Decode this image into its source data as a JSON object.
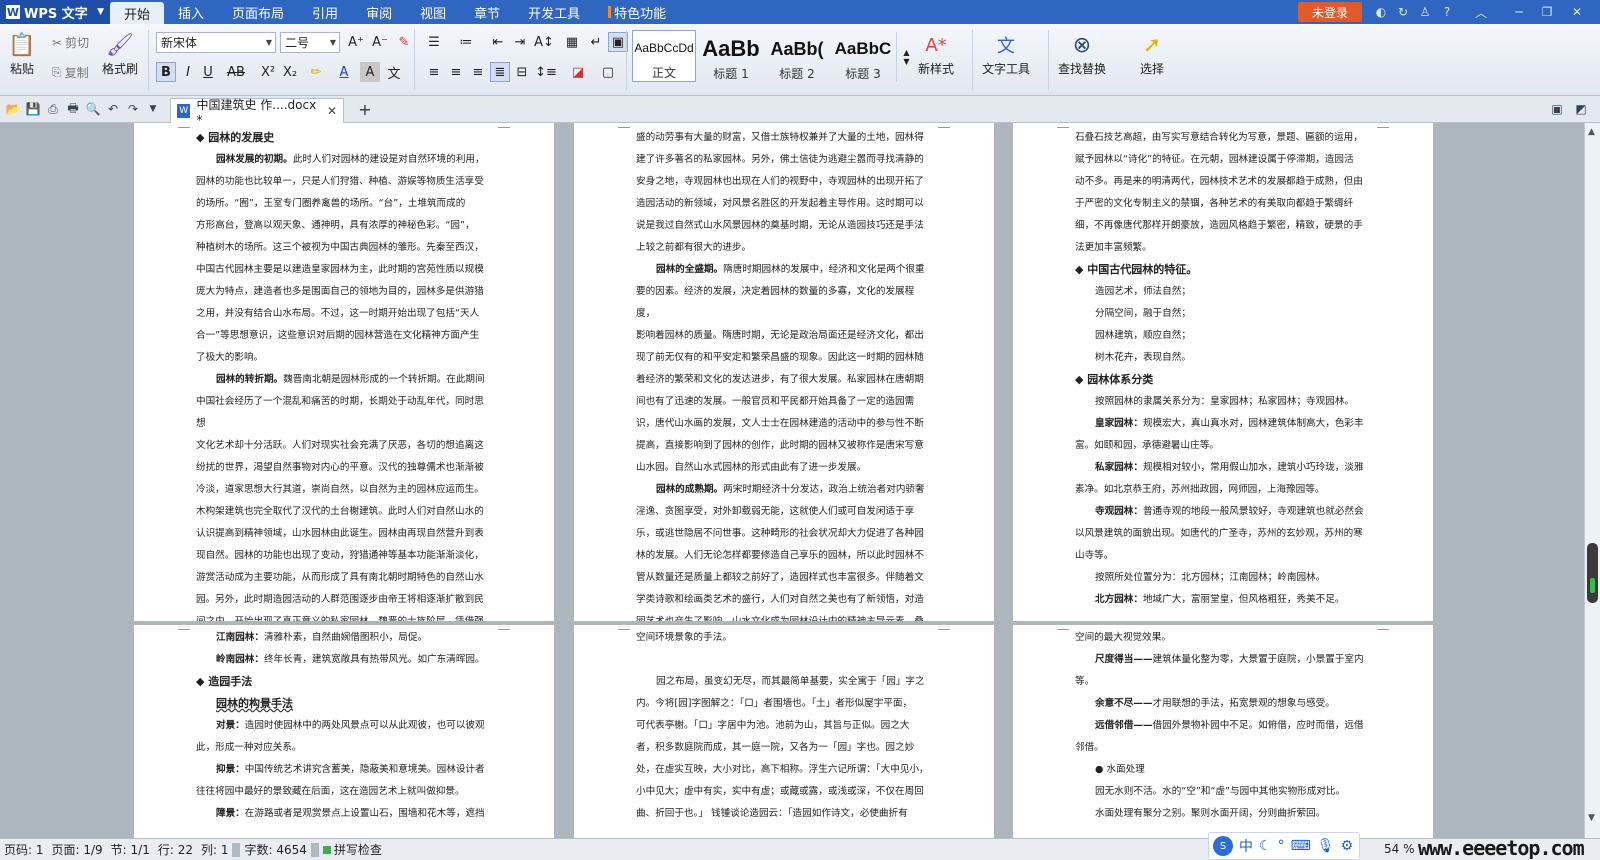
{
  "app": {
    "name": "WPS 文字",
    "login": "未登录"
  },
  "menu": [
    "开始",
    "插入",
    "页面布局",
    "引用",
    "审阅",
    "视图",
    "章节",
    "开发工具",
    "特色功能"
  ],
  "ribbon": {
    "paste": "粘贴",
    "cut": "剪切",
    "copy": "复制",
    "format_painter": "格式刷",
    "font_name": "新宋体",
    "font_size": "二号",
    "styles": [
      {
        "preview": "AaBbCcDd",
        "name": "正文"
      },
      {
        "preview": "AaBb",
        "name": "标题 1"
      },
      {
        "preview": "AaBb(",
        "name": "标题 2"
      },
      {
        "preview": "AaBbC",
        "name": "标题 3"
      }
    ],
    "new_style": "新样式",
    "text_tools": "文字工具",
    "find_replace": "查找替换",
    "select": "选择"
  },
  "tab": {
    "filename": "中国建筑史 作....docx *"
  },
  "pages": {
    "p1": [
      {
        "t": "◆ 园林的发展史",
        "c": "h"
      },
      {
        "t": "园林发展的初期。此时人们对园林的建设是对自然环境的利用，",
        "c": "ind",
        "lead": "园林发展的初期。"
      },
      {
        "t": "园林的功能也比较单一，只是人们狩猎、种植、游娱等物质生活享受"
      },
      {
        "t": "的场所。“囿”，王室专门圈养禽兽的场所。“台”，土堆筑而成的"
      },
      {
        "t": "方形高台，登高以观天象、通神明，具有浓厚的神秘色彩。“园”，"
      },
      {
        "t": "种植树木的场所。这三个被视为中国古典园林的雏形。先秦至西汉，"
      },
      {
        "t": "中国古代园林主要是以建造皇家园林为主，此时期的宫苑性质以规模"
      },
      {
        "t": "庞大为特点，建造者也多是围面自己的领地为目的，园林多是供游猎"
      },
      {
        "t": "之用，并没有结合山水布局。不过，这一时期开始出现了包括“天人"
      },
      {
        "t": "合一”等思想意识，这些意识对后期的园林营造在文化精神方面产生"
      },
      {
        "t": "了极大的影响。"
      },
      {
        "t": "园林的转折期。魏晋南北朝是园林形成的一个转折期。在此期间",
        "c": "ind",
        "lead": "园林的转折期。"
      },
      {
        "t": "中国社会经历了一个混乱和痛苦的时期，长期处于动乱年代，同时思想"
      },
      {
        "t": "文化艺术却十分活跃。人们对现实社会充满了厌恶，各切的想追离这"
      },
      {
        "t": "纷扰的世界，渴望自然事物对内心的平意。汉代的独尊儒术也渐渐被"
      },
      {
        "t": "冷淡，道家思想大行其道，崇尚自然，以自然为主的园林应运而生。"
      },
      {
        "t": "木构架建筑也完全取代了汉代的土台榭建筑。此时人们对自然山水的"
      },
      {
        "t": "认识提高到精神领域，山水园林由此诞生。园林由再现自然营升到表"
      },
      {
        "t": "现自然。园林的功能也出现了变动，狩猎通神等基本功能渐渐淡化，"
      },
      {
        "t": "游赏活动成为主要功能，从而形成了具有南北朝时期特色的自然山水"
      },
      {
        "t": "园。另外，此时期造园活动的人群范围逐步由帝王将相逐渐扩散到民"
      },
      {
        "t": "间之中，开始出现了真正意义的私家园林。魏晋的士族阶层，凭借强"
      }
    ],
    "p2": [
      {
        "t": "盛的动劳事有大量的财富，又借士族特权兼并了大量的土地，园林得"
      },
      {
        "t": "建了许多著名的私家园林。另外，佛土信徒为逃避尘嚣而寻找清静的"
      },
      {
        "t": "安身之地，寺观园林也出现在人们的视野中，寺观园林的出现开拓了"
      },
      {
        "t": "造园活动的新领域，对风景名胜区的开发起着主导作用。这时期可以"
      },
      {
        "t": "说是我过自然式山水风景园林的奠基时期，无论从造园技巧还是手法"
      },
      {
        "t": "上较之前都有很大的进步。"
      },
      {
        "t": "园林的全盛期。隋唐时期园林的发展中，经济和文化是两个很重",
        "c": "ind",
        "lead": "园林的全盛期。"
      },
      {
        "t": "要的因素。经济的发展，决定着园林的数量的多寡，文化的发展程度，"
      },
      {
        "t": "影响着园林的质量。隋唐时期，无论是政治局面还是经济文化，都出"
      },
      {
        "t": "现了前无仅有的和平安定和繁荣昌盛的现象。因此这一时期的园林随"
      },
      {
        "t": "着经济的繁荣和文化的发达进步，有了很大发展。私家园林在唐朝期"
      },
      {
        "t": "间也有了迅速的发展。一般官员和平民都开始具备了一定的造园需"
      },
      {
        "t": "识，唐代山水画的发展，文人士士在园林建造的活动中的参与性不断"
      },
      {
        "t": "提高，直接影响到了园林的创作，此时期的园林又被称作是唐宋写意"
      },
      {
        "t": "山水园。自然山水式园林的形式由此有了进一步发展。"
      },
      {
        "t": "园林的成熟期。两宋时期经济十分发达，政治上统治者对内骄奢",
        "c": "ind",
        "lead": "园林的成熟期。"
      },
      {
        "t": "淫逸、贪图享受，对外卸载弱无能，这就使人们或可自发闲适于享"
      },
      {
        "t": "乐，或逃世隐居不问世事。这种畸形的社会状况却大力促进了各种园"
      },
      {
        "t": "林的发展。人们无论怎样都要修造自己享乐的园林，所以此时园林不"
      },
      {
        "t": "管从数量还是质量上都较之前好了，造园样式也丰富很多。伴随着文"
      },
      {
        "t": "学类诗歌和绘画类艺术的盛行，人们对自然之美也有了新领悟，对造"
      },
      {
        "t": "园艺术也产生了影响。山水文化成为园林设计中的精神主导元素，叠"
      }
    ],
    "p3": [
      {
        "t": "石叠石技艺高超，由写实写意结合转化为写意，景题、匾额的运用，"
      },
      {
        "t": "赋予园林以“诗化”的特征。在元朝，园林建设属于停滞期，造园活"
      },
      {
        "t": "动不多。再是来的明清两代，园林技术艺术的发展都趋于成熟，但由"
      },
      {
        "t": "于严密的文化专制主义的禁锢，各种艺术的有美取向都趋于繁缛纤"
      },
      {
        "t": "细，不再像唐代那样开朗豪放，造园风格趋于繁密，精致，硬景的手"
      },
      {
        "t": "法更加丰富频繁。"
      },
      {
        "t": "◆ 中国古代园林的特征。",
        "c": "h"
      },
      {
        "t": "造园艺术，师法自然；",
        "c": "ind"
      },
      {
        "t": "分隔空间，融于自然；",
        "c": "ind"
      },
      {
        "t": "园林建筑，顺应自然；",
        "c": "ind"
      },
      {
        "t": "树木花卉，表现自然。",
        "c": "ind"
      },
      {
        "t": "◆ 园林体系分类",
        "c": "h"
      },
      {
        "t": "按照园林的隶属关系分为：皇家园林；私家园林；寺观园林。",
        "c": "ind"
      },
      {
        "t": "皇家园林：规模宏大，真山真水对，园林建筑体制高大，色彩丰",
        "c": "ind",
        "lead": "皇家园林："
      },
      {
        "t": "富。如颐和园，承德避暑山庄等。"
      },
      {
        "t": "私家园林：规模相对较小，常用假山加水，建筑小巧玲珑，淡雅",
        "c": "ind",
        "lead": "私家园林："
      },
      {
        "t": "素净。如北京恭王府，苏州拙政园，网师园，上海豫园等。"
      },
      {
        "t": "寺观园林：普通寺观的地段一般风景较好，寺观建筑也就必然会",
        "c": "ind",
        "lead": "寺观园林："
      },
      {
        "t": "以风景建筑的面貌出现。如唐代的广圣寺，苏州的玄妙观，苏州的寒"
      },
      {
        "t": "山寺等。"
      },
      {
        "t": "按照所处位置分为：北方园林；江南园林；岭南园林。",
        "c": "ind"
      },
      {
        "t": "北方园林：地域广大，富丽堂皇，但风格粗狂，秀美不足。",
        "c": "ind",
        "lead": "北方园林："
      }
    ],
    "p4": [
      {
        "t": "江南园林：清雅朴素，自然曲婉借图积小，局促。",
        "c": "ind",
        "lead": "江南园林："
      },
      {
        "t": "岭南园林：终年长青，建筑宽敞具有热带风光。如广东清晖园。",
        "c": "ind",
        "lead": "岭南园林："
      },
      {
        "t": "◆ 造园手法",
        "c": "h"
      },
      {
        "t": "园林的构景手法",
        "c": "h2"
      },
      {
        "t": "对景：造园时使园林中的两处风景点可以从此观彼，也可以彼观",
        "c": "ind",
        "lead": "对景："
      },
      {
        "t": "此，形成一种对应关系。"
      },
      {
        "t": "抑景：中国传统艺术讲究含蓄美，隐蔽美和意境美。园林设计者",
        "c": "ind",
        "lead": "抑景："
      },
      {
        "t": "往往将园中最好的景致藏在后面，这在造园艺术上就叫做抑景。"
      },
      {
        "t": "障景：在游路或者是观赏景点上设置山石，围墙和花木等，遮挡",
        "c": "ind",
        "lead": "障景："
      }
    ],
    "p5": [
      {
        "t": "空间环境景象的手法。"
      },
      {
        "t": ""
      },
      {
        "t": "园之布局，虽变幻无尽，而其最简单基要，实全寓于「园」字之",
        "c": "ind"
      },
      {
        "t": "内。今将[园]字图解之：「口」者围墙也。「土」者形似屋宇平面，"
      },
      {
        "t": "可代表亭榭。「口」字居中为池。池前为山，其旨与正似。园之大"
      },
      {
        "t": "者，积多数庭院而成，其一庭一院，又各为一「园」字也。园之妙"
      },
      {
        "t": "处，在虚实互映，大小对比，高下相称。浮生六记所谓：「大中见小，"
      },
      {
        "t": "小中见大；虚中有实，实中有虚；或藏或露，或浅或深，不仅在周回"
      },
      {
        "t": "曲、折回于也。」  钱锺谈论造园云：「造园如作诗文，必使曲折有"
      }
    ],
    "p6": [
      {
        "t": "空间的最大视觉效果。"
      },
      {
        "t": "尺度得当——建筑体量化整为零，大景置于庭院，小景置于室内",
        "c": "ind",
        "lead": "尺度得当——"
      },
      {
        "t": "等。"
      },
      {
        "t": "余意不尽——才用联想的手法，拓宽景观的想象与感受。",
        "c": "ind",
        "lead": "余意不尽——"
      },
      {
        "t": "远借邻借——借园外景物补园中不足。如俯借，应时而借，远借",
        "c": "ind",
        "lead": "远借邻借——"
      },
      {
        "t": "邻借。"
      },
      {
        "t": "● 水面处理",
        "c": "ind"
      },
      {
        "t": "园无水则不活。水的“空”和“虚”与园中其他实物形成对比。",
        "c": "ind"
      },
      {
        "t": "水面处理有聚分之别。聚则水面开阔，分则曲折萦回。",
        "c": "ind"
      },
      {
        "t": "",
        "c": "ind"
      }
    ]
  },
  "status": {
    "page_no": "页码: 1",
    "page": "页面: 1/9",
    "section": "节: 1/1",
    "row": "行: 22",
    "col": "列: 1",
    "words": "字数: 4654",
    "spell": "拼写检查",
    "zoom": "54 %",
    "ime": "中"
  },
  "watermark": "www.eeeetop.com"
}
